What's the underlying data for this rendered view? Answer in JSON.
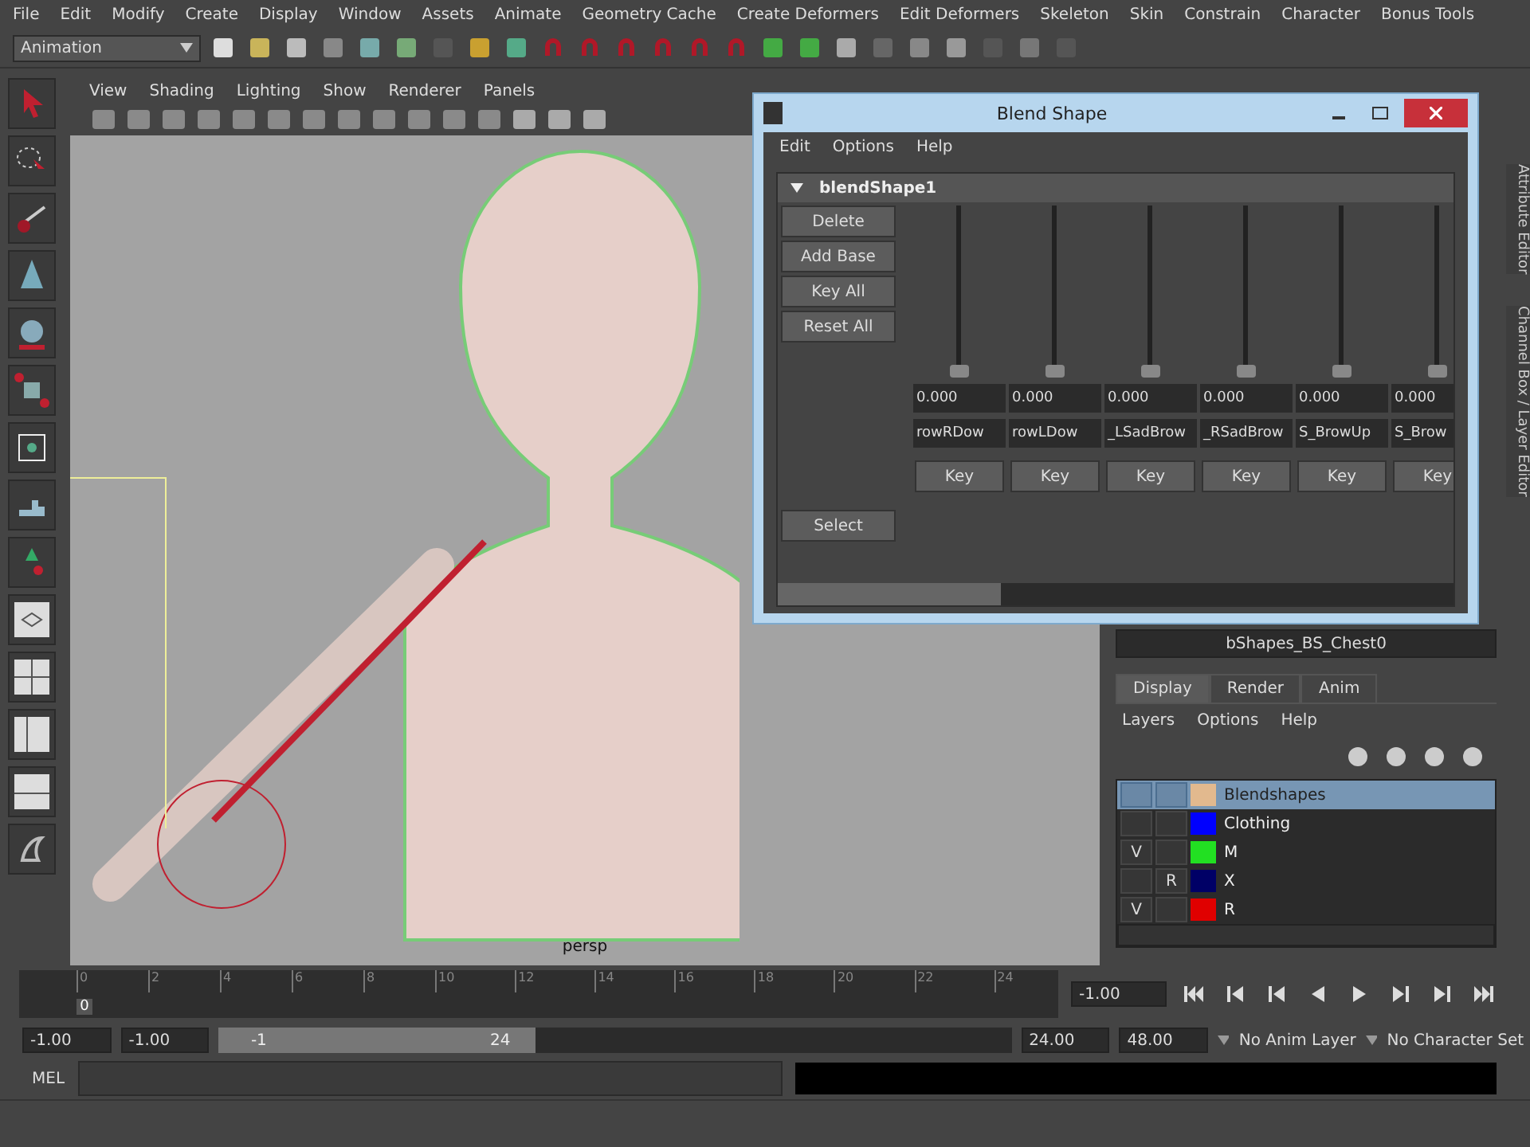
{
  "menu_bar": [
    "File",
    "Edit",
    "Modify",
    "Create",
    "Display",
    "Window",
    "Assets",
    "Animate",
    "Geometry Cache",
    "Create Deformers",
    "Edit Deformers",
    "Skeleton",
    "Skin",
    "Constrain",
    "Character",
    "Bonus Tools"
  ],
  "toolbar": {
    "mode": "Animation"
  },
  "viewport": {
    "menu": [
      "View",
      "Shading",
      "Lighting",
      "Show",
      "Renderer",
      "Panels"
    ],
    "camera": "persp"
  },
  "blend_shape_window": {
    "title": "Blend Shape",
    "menu": [
      "Edit",
      "Options",
      "Help"
    ],
    "node": {
      "name": "blendShape1",
      "expanded": true
    },
    "buttons": [
      "Delete",
      "Add Base",
      "Key All",
      "Reset All"
    ],
    "select_button": "Select",
    "targets": [
      {
        "value": "0.000",
        "name": "rowRDow",
        "level": 0,
        "key": "Key"
      },
      {
        "value": "0.000",
        "name": "rowLDow",
        "level": 0,
        "key": "Key"
      },
      {
        "value": "0.000",
        "name": "_LSadBrow",
        "level": 0,
        "key": "Key"
      },
      {
        "value": "0.000",
        "name": "_RSadBrow",
        "level": 0,
        "key": "Key"
      },
      {
        "value": "0.000",
        "name": "S_BrowUp",
        "level": 0,
        "key": "Key"
      },
      {
        "value": "0.000",
        "name": "S_Brow",
        "level": 0,
        "key": "Key"
      }
    ]
  },
  "channel_box": {
    "field": "bShapes_BS_Chest0"
  },
  "layer_editor": {
    "tabs": [
      {
        "label": "Display",
        "selected": true
      },
      {
        "label": "Render",
        "selected": false
      },
      {
        "label": "Anim",
        "selected": false
      }
    ],
    "menu": [
      "Layers",
      "Options",
      "Help"
    ],
    "layers": [
      {
        "name": "Blendshapes",
        "selected": true,
        "color": "#e2b98e"
      },
      {
        "name": "Clothing",
        "selected": false,
        "color": "#0000ff"
      },
      {
        "name": "M",
        "selected": false,
        "color": "#22e022",
        "visibility": "V"
      },
      {
        "name": "X",
        "selected": false,
        "color": "#000066",
        "reference": "R"
      },
      {
        "name": "R",
        "selected": false,
        "color": "#e00000",
        "visibility": "V"
      }
    ]
  },
  "side_tabs": [
    "Attribute Editor",
    "Channel Box / Layer Editor"
  ],
  "time_slider": {
    "ticks": [
      "0",
      "2",
      "4",
      "6",
      "8",
      "10",
      "12",
      "14",
      "16",
      "18",
      "20",
      "22",
      "24"
    ],
    "current_frame": "0",
    "level": 0.04,
    "current_time": "-1.00"
  },
  "range_slider": {
    "start": "-1.00",
    "range_start": "-1.00",
    "bar_start": "-1",
    "bar_end": "24",
    "level": 0.4,
    "range_end": "24.00",
    "end": "48.00",
    "anim_layer": "No Anim Layer",
    "character_set": "No Character Set"
  },
  "command_line": {
    "label": "MEL"
  }
}
